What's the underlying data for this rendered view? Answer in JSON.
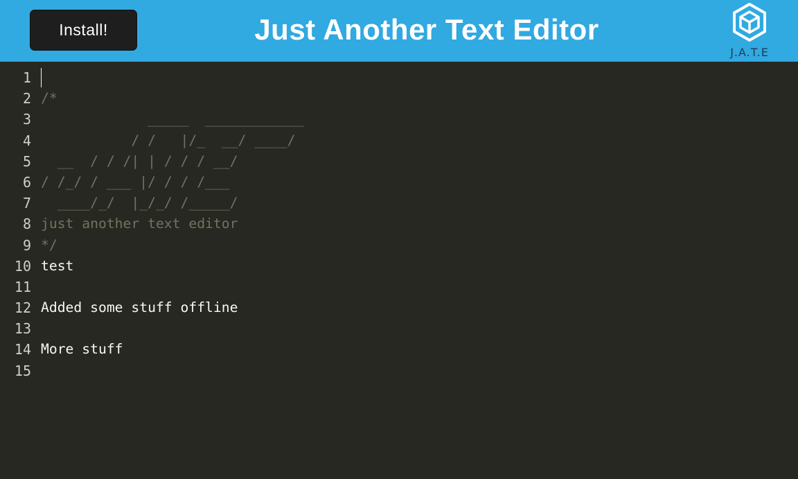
{
  "navbar": {
    "install_label": "Install!",
    "title": "Just Another Text Editor",
    "logo_text": "J.A.T.E",
    "background_color": "#31a9e1"
  },
  "editor": {
    "background_color": "#272822",
    "comment_color": "#75715e",
    "text_color": "#f8f8f2",
    "line_numbers": [
      "1",
      "2",
      "3",
      "4",
      "5",
      "6",
      "7",
      "8",
      "9",
      "10",
      "11",
      "12",
      "13",
      "14",
      "15"
    ],
    "lines": [
      {
        "text": "",
        "kind": "text"
      },
      {
        "text": "/*",
        "kind": "comment"
      },
      {
        "text": "             _____  ____________",
        "kind": "comment"
      },
      {
        "text": "           / /   |/_  __/ ____/",
        "kind": "comment"
      },
      {
        "text": "  __  / / /| | / / / __/",
        "kind": "comment"
      },
      {
        "text": "/ /_/ / ___ |/ / / /___",
        "kind": "comment"
      },
      {
        "text": "  ____/_/  |_/_/ /_____/",
        "kind": "comment"
      },
      {
        "text": "just another text editor",
        "kind": "comment"
      },
      {
        "text": "*/",
        "kind": "comment"
      },
      {
        "text": "test",
        "kind": "text"
      },
      {
        "text": "",
        "kind": "text"
      },
      {
        "text": "Added some stuff offline",
        "kind": "text"
      },
      {
        "text": "",
        "kind": "text"
      },
      {
        "text": "More stuff",
        "kind": "text"
      },
      {
        "text": "",
        "kind": "text"
      }
    ]
  }
}
